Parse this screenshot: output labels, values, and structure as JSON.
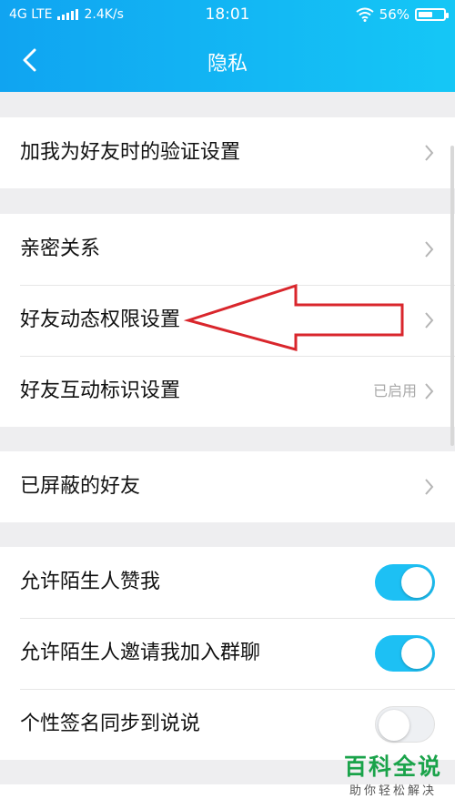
{
  "status_bar": {
    "network": "4G LTE",
    "speed": "2.4K/s",
    "time": "18:01",
    "battery": "56%",
    "battery_level": 0.56
  },
  "header": {
    "title": "隐私",
    "back_icon": "chevron-left-icon"
  },
  "groups": [
    {
      "rows": [
        {
          "label": "加我为好友时的验证设置",
          "control": "chevron"
        }
      ]
    },
    {
      "rows": [
        {
          "label": "亲密关系",
          "control": "chevron"
        },
        {
          "label": "好友动态权限设置",
          "control": "chevron"
        },
        {
          "label": "好友互动标识设置",
          "control": "chevron",
          "value": "已启用"
        }
      ]
    },
    {
      "rows": [
        {
          "label": "已屏蔽的好友",
          "control": "chevron"
        }
      ]
    },
    {
      "rows": [
        {
          "label": "允许陌生人赞我",
          "control": "toggle",
          "on": true
        },
        {
          "label": "允许陌生人邀请我加入群聊",
          "control": "toggle",
          "on": true
        },
        {
          "label": "个性签名同步到说说",
          "control": "toggle",
          "on": false
        }
      ]
    }
  ],
  "annotation": {
    "color": "#d9262c"
  },
  "colors": {
    "header_start": "#10a4f1",
    "header_end": "#15c7f6",
    "toggle_on": "#1dc0f4"
  },
  "watermark": {
    "main": "百科全说",
    "sub": "助你轻松解决"
  }
}
